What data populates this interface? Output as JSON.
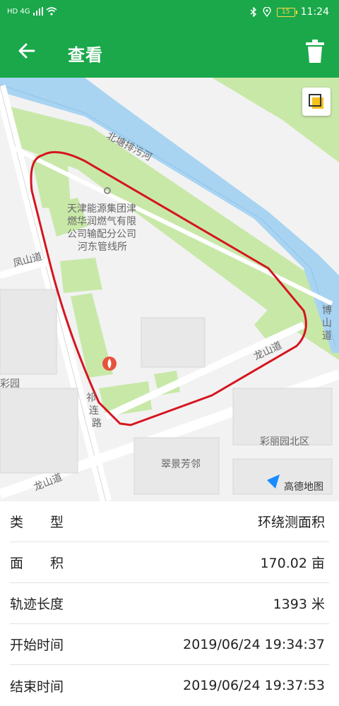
{
  "status_bar": {
    "network": "HD 4G",
    "time": "11:24",
    "battery": "15"
  },
  "app_bar": {
    "title": "查看"
  },
  "map": {
    "labels": {
      "canal": "北塘排污河",
      "poi": [
        "天津能源集团津",
        "燃华润燃气有限",
        "公司输配分公司",
        "河东管线所"
      ],
      "fengshan_road": "凤山道",
      "longshan_road_right": "龙山道",
      "longshan_road_left": "龙山道",
      "zhulian_road": [
        "祁",
        "连",
        "路"
      ],
      "boshan_road": [
        "博",
        "山",
        "道"
      ],
      "cuijing": "翠景芳邻",
      "caili": "彩丽园北区",
      "yuan": "彩园",
      "brand": "高德地图"
    }
  },
  "info": {
    "rows": [
      {
        "label": "类　　型",
        "value": "环绕测面积"
      },
      {
        "label": "面　　积",
        "value": "170.02 亩"
      },
      {
        "label": "轨迹长度",
        "value": "1393 米"
      },
      {
        "label": "开始时间",
        "value": "2019/06/24 19:34:37"
      },
      {
        "label": "结束时间",
        "value": "2019/06/24 19:37:53"
      }
    ]
  },
  "colors": {
    "primary": "#1aa84a",
    "track": "#d5151f",
    "water": "#a8d4f2",
    "green_area": "#c8e8a8"
  }
}
